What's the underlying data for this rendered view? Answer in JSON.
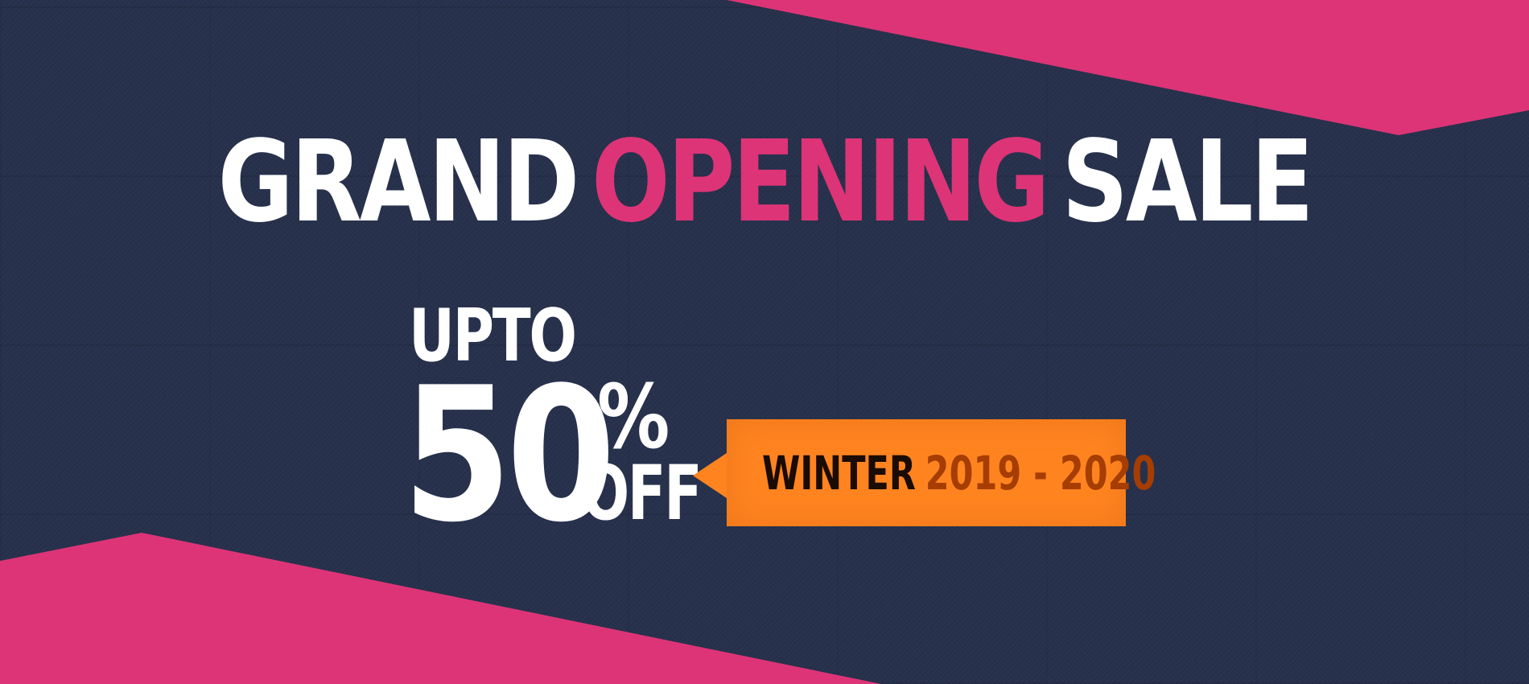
{
  "colors": {
    "background_denim": "#27314c",
    "accent_pink": "#dd3477",
    "white": "#ffffff",
    "tag_orange": "#ff8420",
    "dark_text": "#1a0b03",
    "brown_text": "#a63d02"
  },
  "headline": {
    "word1": "GRAND",
    "word2": "OPENING",
    "word3": "SALE"
  },
  "offer": {
    "upto": "UPTO",
    "amount": "50",
    "percent": "%",
    "off": "OFF"
  },
  "tag": {
    "season": "WINTER",
    "years": "2019 - 2020"
  }
}
